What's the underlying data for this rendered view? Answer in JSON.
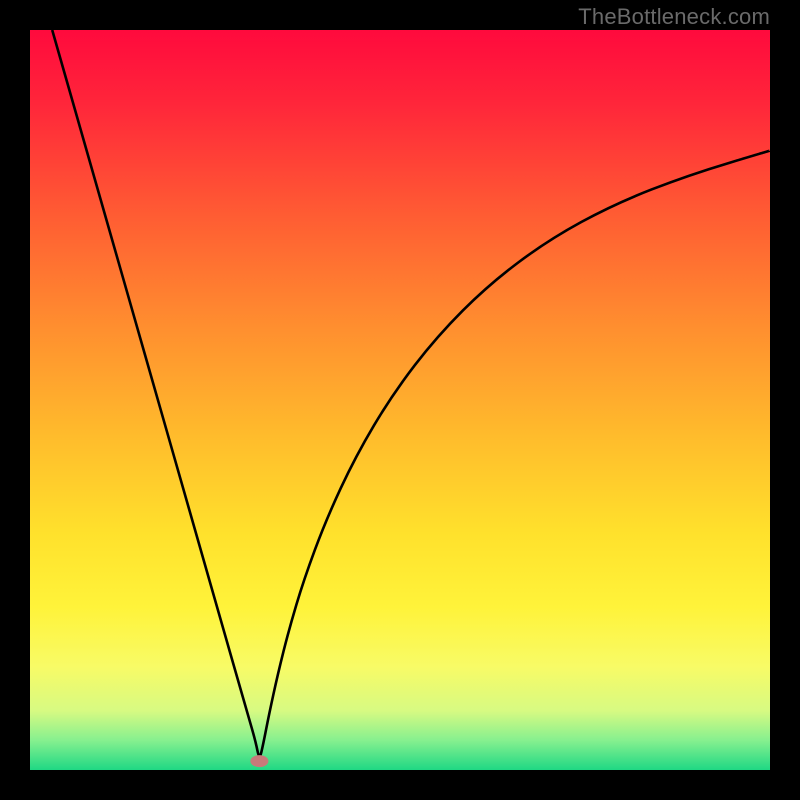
{
  "watermark": "TheBottleneck.com",
  "chart_data": {
    "type": "line",
    "title": "",
    "xlabel": "",
    "ylabel": "",
    "xlim": [
      0,
      100
    ],
    "ylim": [
      0,
      100
    ],
    "background": {
      "type": "vertical-gradient",
      "stops": [
        {
          "offset": 0.0,
          "color": "#ff0a3d"
        },
        {
          "offset": 0.1,
          "color": "#ff263a"
        },
        {
          "offset": 0.25,
          "color": "#ff5c33"
        },
        {
          "offset": 0.4,
          "color": "#ff8e2f"
        },
        {
          "offset": 0.55,
          "color": "#ffbc2c"
        },
        {
          "offset": 0.68,
          "color": "#ffe12c"
        },
        {
          "offset": 0.78,
          "color": "#fff33a"
        },
        {
          "offset": 0.86,
          "color": "#f8fb66"
        },
        {
          "offset": 0.92,
          "color": "#d7fa82"
        },
        {
          "offset": 0.96,
          "color": "#86f08f"
        },
        {
          "offset": 1.0,
          "color": "#1fd884"
        }
      ]
    },
    "marker": {
      "x": 31,
      "y": 1.2,
      "color": "#c77a7a",
      "rx": 9,
      "ry": 6
    },
    "series": [
      {
        "name": "curve",
        "color": "#000000",
        "x": [
          3,
          5,
          8,
          11,
          14,
          17,
          20,
          23,
          26,
          28,
          29.5,
          30.5,
          31,
          31.5,
          32.3,
          33.5,
          35,
          37,
          40,
          44,
          49,
          55,
          62,
          70,
          79,
          89,
          100
        ],
        "y": [
          100,
          93,
          82.5,
          72,
          61.5,
          51,
          40.5,
          30,
          19.5,
          12.5,
          7.3,
          3.8,
          1.3,
          3.4,
          7.5,
          13,
          19,
          25.7,
          33.8,
          42.4,
          50.8,
          58.6,
          65.6,
          71.6,
          76.5,
          80.4,
          83.7
        ]
      }
    ]
  }
}
